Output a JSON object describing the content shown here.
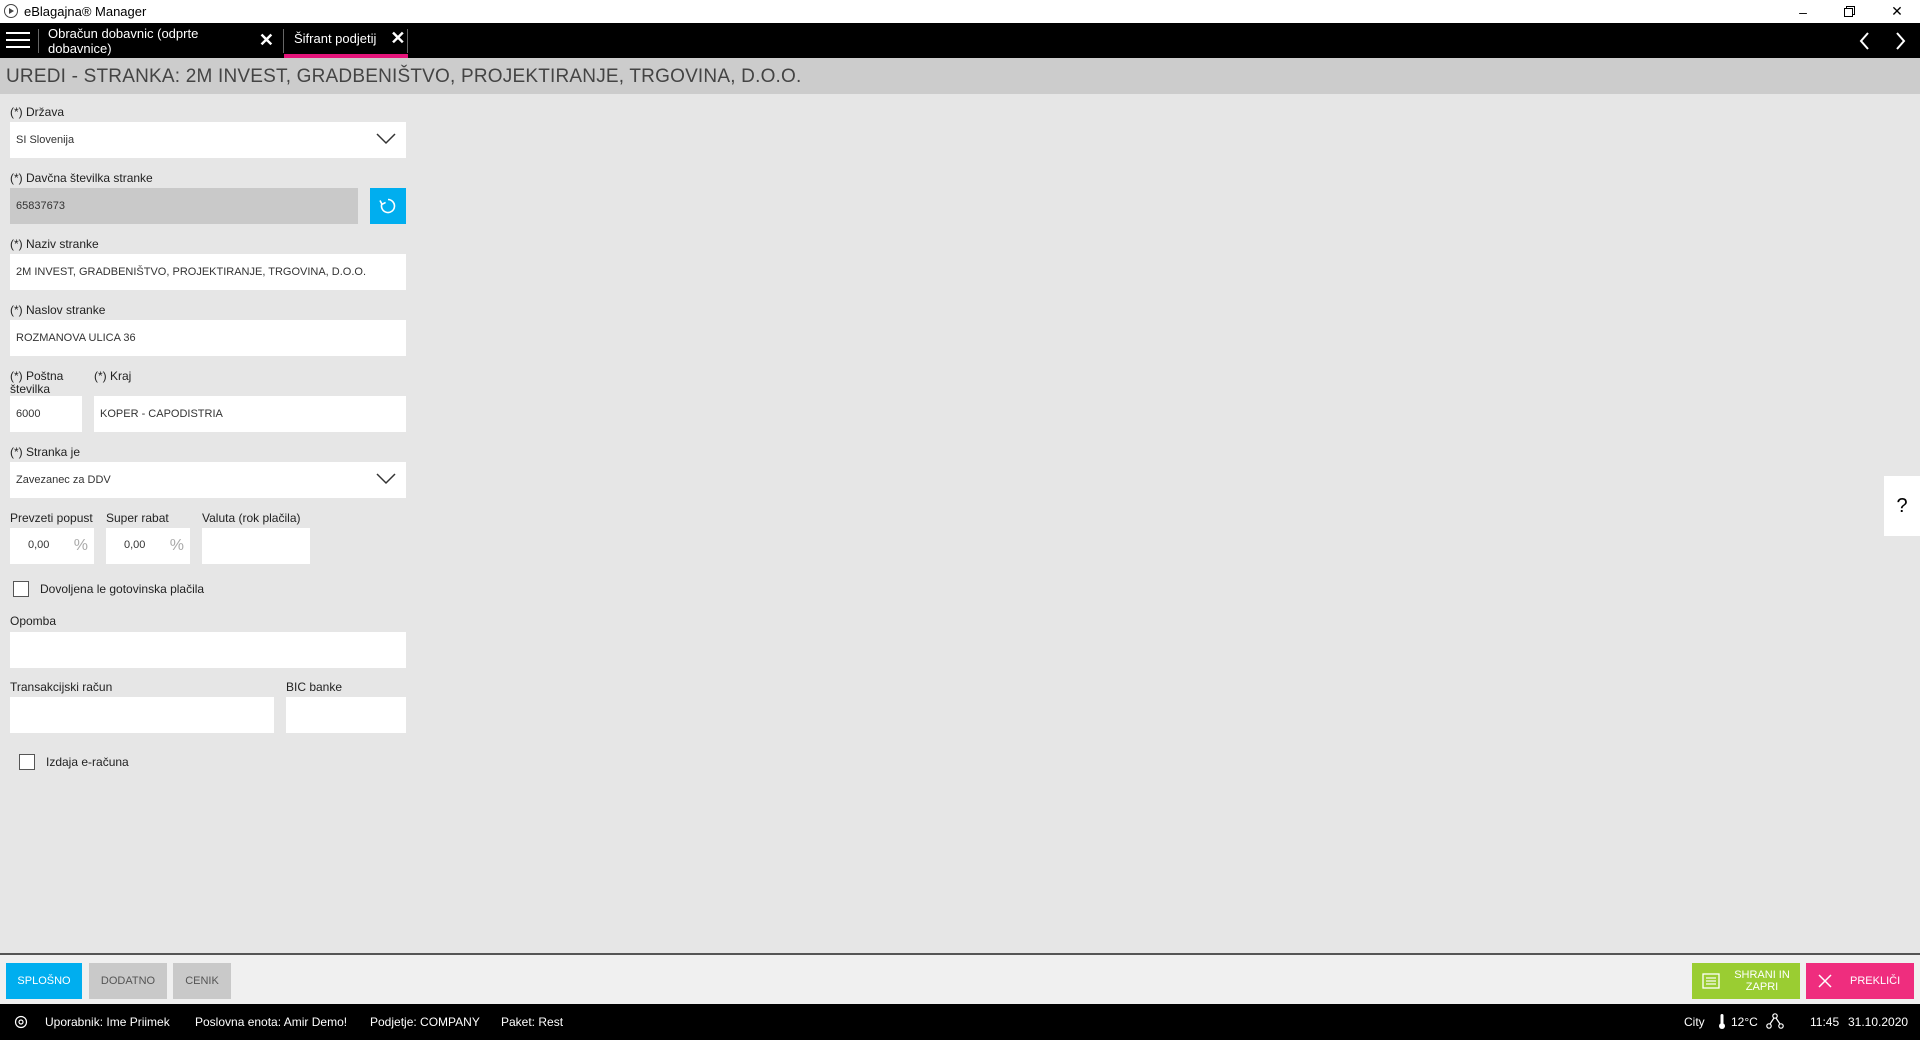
{
  "window": {
    "title": "eBlagajna® Manager"
  },
  "tabs": [
    {
      "label": "Obračun dobavnic (odprte dobavnice)"
    },
    {
      "label": "Šifrant podjetij"
    }
  ],
  "page": {
    "title": "UREDI - STRANKA: 2M INVEST, GRADBENIŠTVO, PROJEKTIRANJE, TRGOVINA, D.O.O."
  },
  "form": {
    "country_label": "(*) Država",
    "country_value": "SI Slovenija",
    "tax_label": "(*) Davčna številka stranke",
    "tax_value": "65837673",
    "name_label": "(*) Naziv stranke",
    "name_value": "2M INVEST, GRADBENIŠTVO, PROJEKTIRANJE, TRGOVINA, D.O.O.",
    "address_label": "(*) Naslov stranke",
    "address_value": "ROZMANOVA ULICA 36",
    "postal_label_1": "(*) Poštna",
    "postal_label_2": "številka",
    "postal_value": "6000",
    "city_label": "(*) Kraj",
    "city_value": "KOPER - CAPODISTRIA",
    "type_label": "(*) Stranka je",
    "type_value": "Zavezanec za DDV",
    "discount_label": "Prevzeti popust",
    "discount_value": "0,00",
    "super_rabat_label": "Super rabat",
    "super_rabat_value": "0,00",
    "percent_sign": "%",
    "currency_label": "Valuta (rok plačila)",
    "currency_value": "",
    "cash_only_label": "Dovoljena le gotovinska plačila",
    "note_label": "Opomba",
    "note_value": "",
    "bank_account_label": "Transakcijski račun",
    "bank_account_value": "",
    "bic_label": "BIC banke",
    "bic_value": "",
    "einvoice_label": "Izdaja e-računa"
  },
  "help": {
    "label": "?"
  },
  "bottom_tabs": [
    {
      "label": "SPLOŠNO"
    },
    {
      "label": "DODATNO"
    },
    {
      "label": "CENIK"
    }
  ],
  "actions": {
    "save_line1": "SHRANI IN",
    "save_line2": "ZAPRI",
    "cancel": "PREKLIČI"
  },
  "status": {
    "user": "Uporabnik: Ime Priimek",
    "unit": "Poslovna enota: Amir Demo!",
    "company": "Podjetje: COMPANY",
    "package": "Paket: Rest",
    "city": "City",
    "temperature": "12°C",
    "time": "11:45",
    "date": "31.10.2020"
  },
  "colors": {
    "accent_blue": "#00aeef",
    "save_green": "#9acd32",
    "cancel_pink": "#ef2d7e",
    "tab_underline": "#e4147a"
  }
}
